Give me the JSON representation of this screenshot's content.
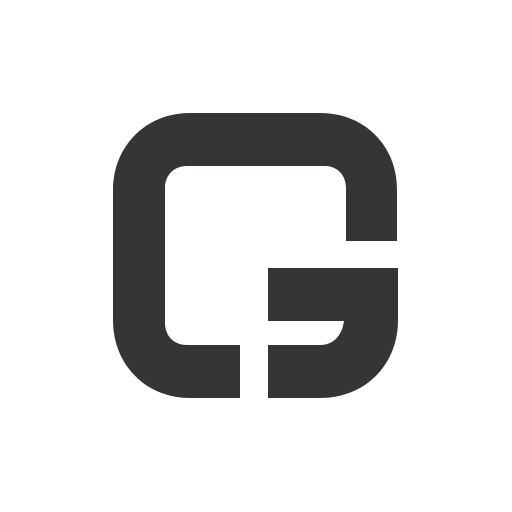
{
  "logo": {
    "icon": "g-letter-logo-icon",
    "color": "#363435"
  },
  "background": {
    "color": "#ffffff"
  }
}
